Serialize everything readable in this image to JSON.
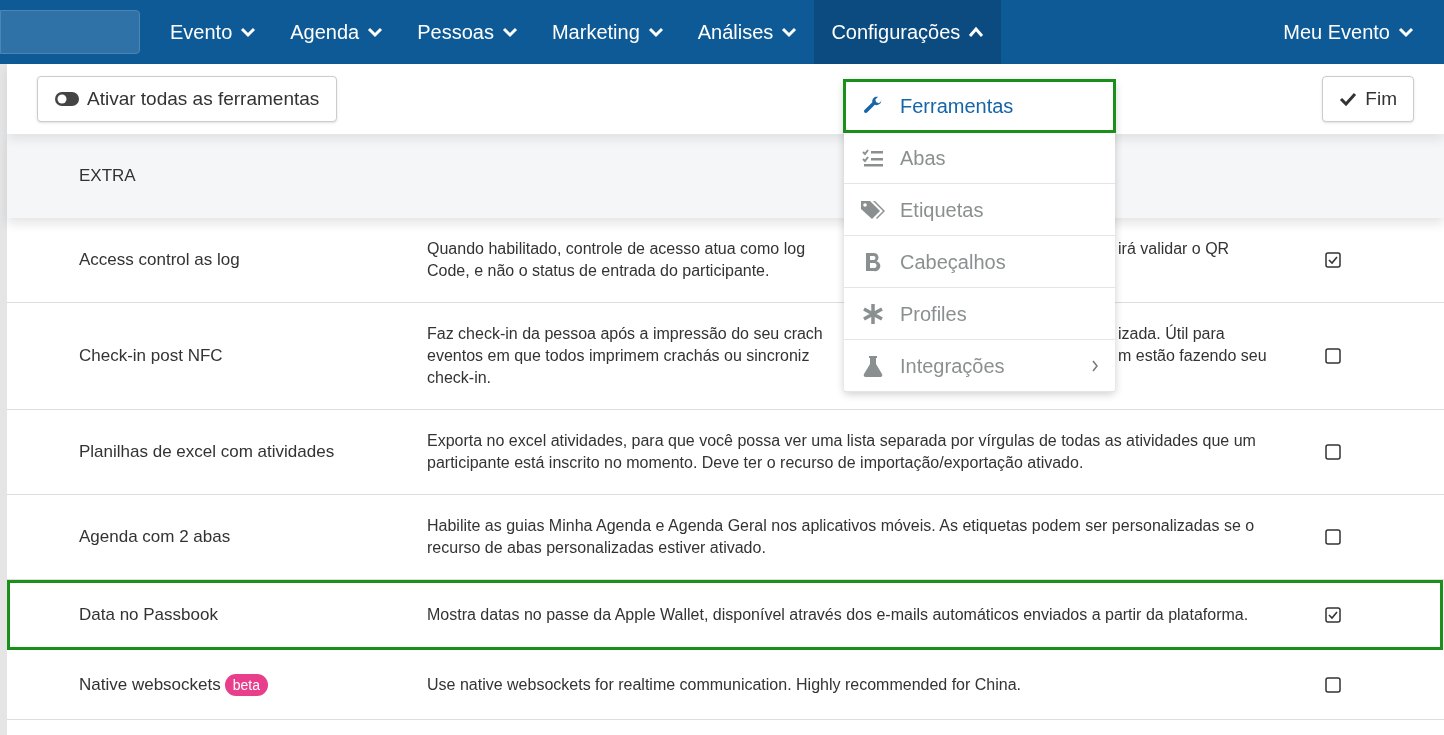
{
  "nav": {
    "items": [
      {
        "label": "Evento",
        "expanded": false,
        "selected": false
      },
      {
        "label": "Agenda",
        "expanded": false,
        "selected": false
      },
      {
        "label": "Pessoas",
        "expanded": false,
        "selected": false
      },
      {
        "label": "Marketing",
        "expanded": false,
        "selected": false
      },
      {
        "label": "Análises",
        "expanded": false,
        "selected": false
      },
      {
        "label": "Configurações",
        "expanded": true,
        "selected": true
      }
    ],
    "account": {
      "label": "Meu Evento",
      "expanded": false
    }
  },
  "toolbar": {
    "toggle_all": "Ativar todas as ferramentas",
    "done": "Fim"
  },
  "section": "EXTRA",
  "rows": [
    {
      "name": "Access control as log",
      "checked": true,
      "highlighted": false,
      "lines": [
        {
          "left": "Quando habilitado, controle de acesso atua como log",
          "right": "irá validar o QR"
        },
        {
          "left": "Code, e não o status de entrada do participante."
        }
      ]
    },
    {
      "name": "Check-in post NFC",
      "checked": false,
      "highlighted": false,
      "lines": [
        {
          "left": "Faz check-in da pessoa após a impressão do seu crach",
          "right": "izada. Útil para"
        },
        {
          "left": "eventos em que todos imprimem crachás ou sincroniz",
          "right": "m estão fazendo seu"
        },
        {
          "left": "check-in."
        }
      ]
    },
    {
      "name": "Planilhas de excel com atividades",
      "checked": false,
      "highlighted": false,
      "description": "Exporta no excel atividades, para que você possa ver uma lista separada por vírgulas de todas as atividades que um participante está inscrito no momento. Deve ter o recurso de importação/exportação ativado."
    },
    {
      "name": "Agenda com 2 abas",
      "checked": false,
      "highlighted": false,
      "description": "Habilite as guias Minha Agenda e Agenda Geral nos aplicativos móveis. As etiquetas podem ser personalizadas se o recurso de abas personalizadas estiver ativado."
    },
    {
      "name": "Data no Passbook",
      "checked": true,
      "highlighted": true,
      "description": "Mostra datas no passe da Apple Wallet, disponível através dos e-mails automáticos enviados a partir da plataforma."
    },
    {
      "name": "Native websockets",
      "badge": "beta",
      "checked": false,
      "highlighted": false,
      "description": "Use native websockets for realtime communication. Highly recommended for China."
    }
  ],
  "menu": {
    "items": [
      {
        "label": "Ferramentas",
        "kind": "wrench",
        "selected": true
      },
      {
        "label": "Abas",
        "kind": "list",
        "selected": false
      },
      {
        "label": "Etiquetas",
        "kind": "tags",
        "selected": false
      },
      {
        "label": "Cabeçalhos",
        "kind": "bold",
        "selected": false
      },
      {
        "label": "Profiles",
        "kind": "asterisk",
        "selected": false
      },
      {
        "label": "Integrações",
        "kind": "flask",
        "selected": false,
        "submenu": true
      }
    ]
  }
}
